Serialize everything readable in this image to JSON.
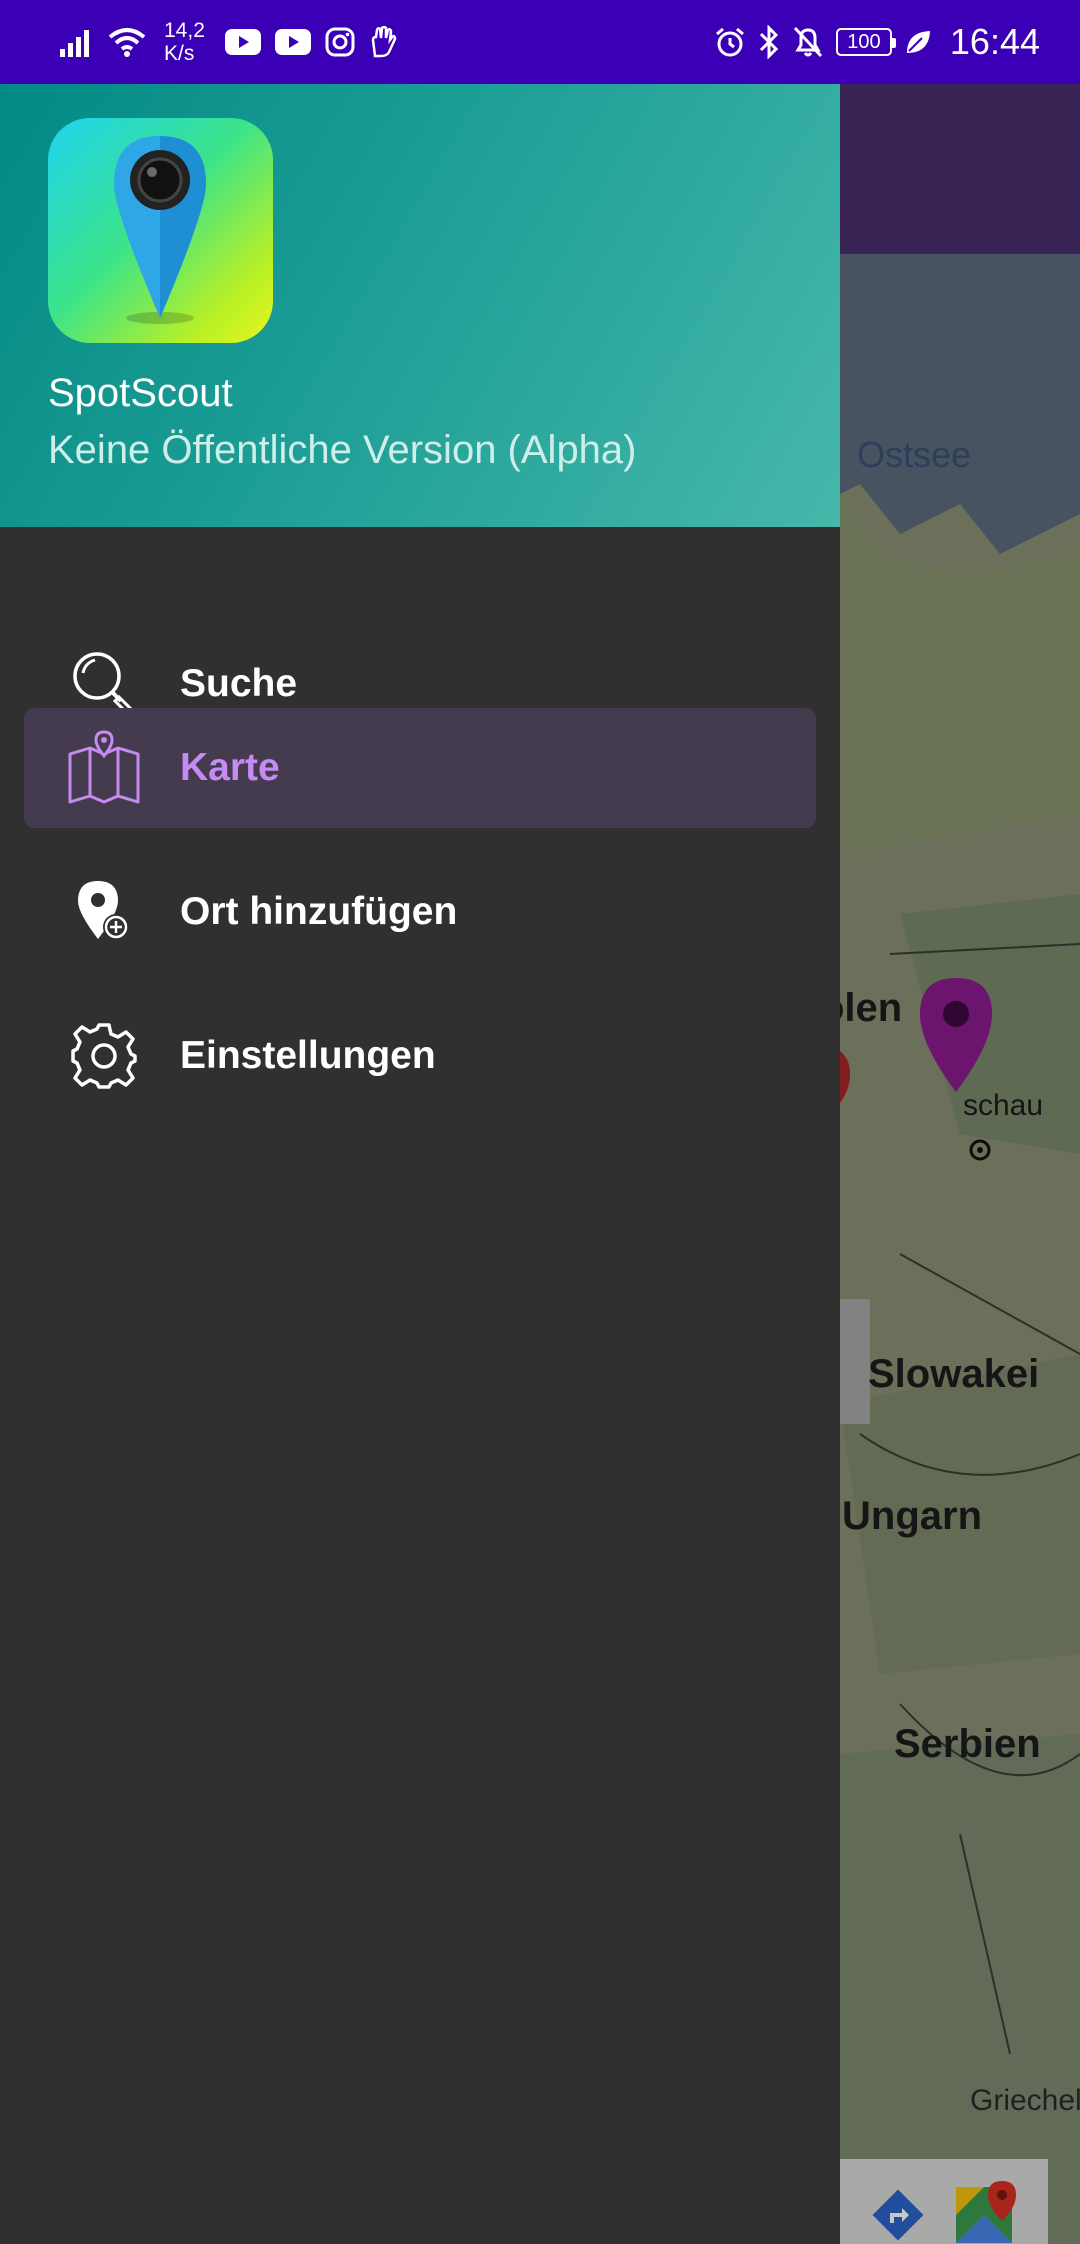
{
  "status_bar": {
    "net_speed_value": "14,2",
    "net_speed_unit": "K/s",
    "battery": "100",
    "time": "16:44"
  },
  "map": {
    "water_label": "Ostsee",
    "country_labels": [
      "olen",
      "Slowakei",
      "Ungarn",
      "Serbien"
    ],
    "city_label": "schau",
    "partial_label": "Griechel"
  },
  "drawer": {
    "app_name": "SpotScout",
    "app_subtitle": "Keine Öffentliche Version (Alpha)",
    "items": [
      {
        "label": "Suche",
        "icon": "search-icon",
        "active": false
      },
      {
        "label": "Karte",
        "icon": "map-icon",
        "active": true
      },
      {
        "label": "Ort hinzufügen",
        "icon": "add-location-icon",
        "active": false
      },
      {
        "label": "Einstellungen",
        "icon": "gear-icon",
        "active": false
      }
    ]
  },
  "colors": {
    "status_bar": "#3b00b5",
    "drawer_background": "#303030",
    "active_item_background": "#443b4f",
    "active_item_text": "#c58bf2",
    "header_gradient_start": "#028a84",
    "header_gradient_end": "#46b8aa"
  }
}
